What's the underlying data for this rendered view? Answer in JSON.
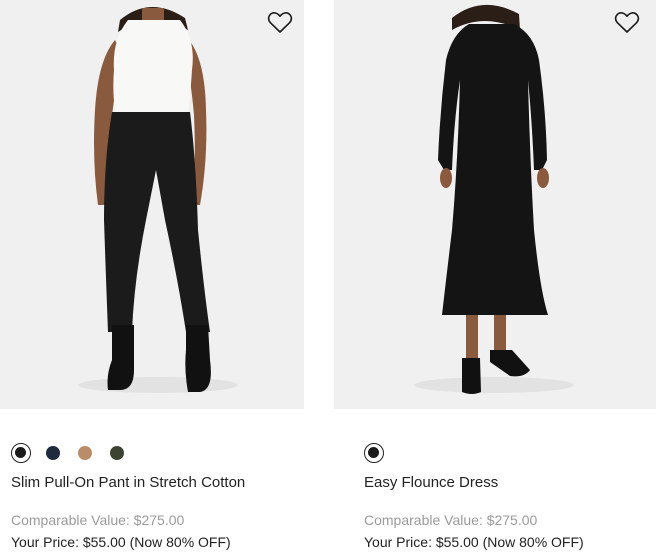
{
  "products": [
    {
      "name": "Slim Pull-On Pant in Stretch Cotton",
      "comparable_label": "Comparable Value: $275.00",
      "price_label": "Your Price: $55.00 (Now 80% OFF)",
      "image_alt": "Model wearing white sleeveless top and black cropped pants",
      "wishlist_icon": "heart-outline-icon",
      "swatches": [
        {
          "color": "#1a1a1a",
          "selected": true
        },
        {
          "color": "#1e2a3d",
          "selected": false
        },
        {
          "color": "#b98c6a",
          "selected": false
        },
        {
          "color": "#3d4331",
          "selected": false
        }
      ]
    },
    {
      "name": "Easy Flounce Dress",
      "comparable_label": "Comparable Value: $275.00",
      "price_label": "Your Price: $55.00 (Now 80% OFF)",
      "image_alt": "Model wearing black long-sleeve midi dress",
      "wishlist_icon": "heart-outline-icon",
      "swatches": [
        {
          "color": "#1a1a1a",
          "selected": true
        }
      ]
    }
  ]
}
